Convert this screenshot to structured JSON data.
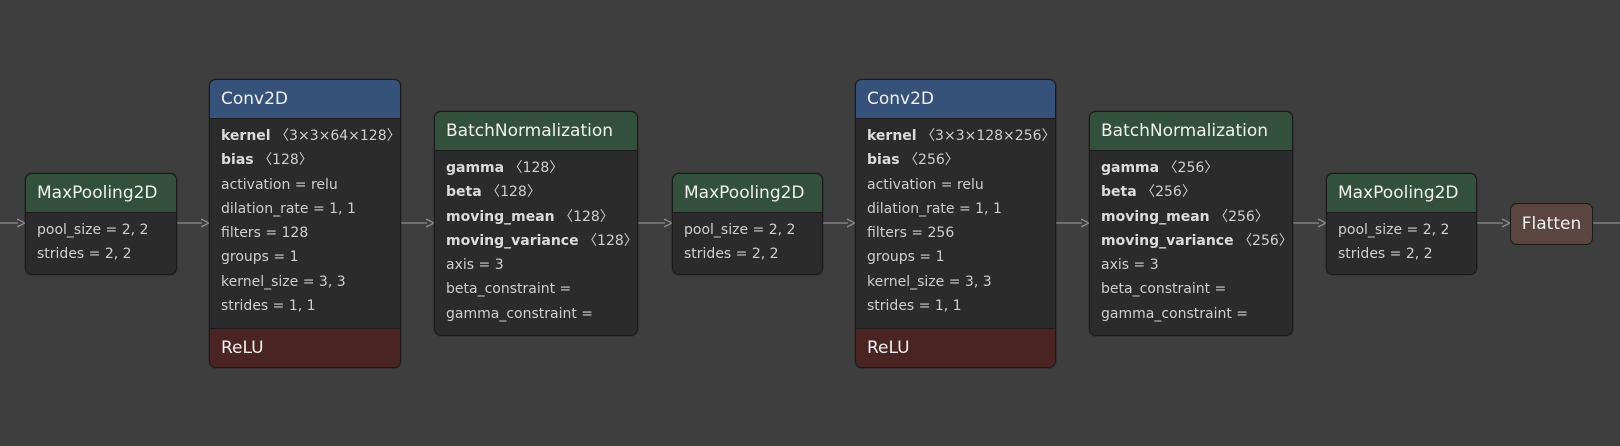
{
  "graph": {
    "edge_color": "#8a8a8a",
    "nodes": [
      {
        "id": "maxpool-1",
        "type": "MaxPooling2D",
        "attrs": [
          {
            "name": "pool_size",
            "value": "2, 2"
          },
          {
            "name": "strides",
            "value": "2, 2"
          }
        ]
      },
      {
        "id": "conv2d-1",
        "type": "Conv2D",
        "weights": [
          {
            "name": "kernel",
            "shape": "〈3×3×64×128〉"
          },
          {
            "name": "bias",
            "shape": "〈128〉"
          }
        ],
        "attrs": [
          {
            "name": "activation",
            "value": "relu"
          },
          {
            "name": "dilation_rate",
            "value": "1, 1"
          },
          {
            "name": "filters",
            "value": "128"
          },
          {
            "name": "groups",
            "value": "1"
          },
          {
            "name": "kernel_size",
            "value": "3, 3"
          },
          {
            "name": "strides",
            "value": "1, 1"
          }
        ],
        "activation": "ReLU"
      },
      {
        "id": "batchnorm-1",
        "type": "BatchNormalization",
        "weights": [
          {
            "name": "gamma",
            "shape": "〈128〉"
          },
          {
            "name": "beta",
            "shape": "〈128〉"
          },
          {
            "name": "moving_mean",
            "shape": "〈128〉"
          },
          {
            "name": "moving_variance",
            "shape": "〈128〉"
          }
        ],
        "attrs": [
          {
            "name": "axis",
            "value": "3"
          },
          {
            "name": "beta_constraint",
            "value": ""
          },
          {
            "name": "gamma_constraint",
            "value": ""
          }
        ]
      },
      {
        "id": "maxpool-2",
        "type": "MaxPooling2D",
        "attrs": [
          {
            "name": "pool_size",
            "value": "2, 2"
          },
          {
            "name": "strides",
            "value": "2, 2"
          }
        ]
      },
      {
        "id": "conv2d-2",
        "type": "Conv2D",
        "weights": [
          {
            "name": "kernel",
            "shape": "〈3×3×128×256〉"
          },
          {
            "name": "bias",
            "shape": "〈256〉"
          }
        ],
        "attrs": [
          {
            "name": "activation",
            "value": "relu"
          },
          {
            "name": "dilation_rate",
            "value": "1, 1"
          },
          {
            "name": "filters",
            "value": "256"
          },
          {
            "name": "groups",
            "value": "1"
          },
          {
            "name": "kernel_size",
            "value": "3, 3"
          },
          {
            "name": "strides",
            "value": "1, 1"
          }
        ],
        "activation": "ReLU"
      },
      {
        "id": "batchnorm-2",
        "type": "BatchNormalization",
        "weights": [
          {
            "name": "gamma",
            "shape": "〈256〉"
          },
          {
            "name": "beta",
            "shape": "〈256〉"
          },
          {
            "name": "moving_mean",
            "shape": "〈256〉"
          },
          {
            "name": "moving_variance",
            "shape": "〈256〉"
          }
        ],
        "attrs": [
          {
            "name": "axis",
            "value": "3"
          },
          {
            "name": "beta_constraint",
            "value": ""
          },
          {
            "name": "gamma_constraint",
            "value": ""
          }
        ]
      },
      {
        "id": "maxpool-3",
        "type": "MaxPooling2D",
        "attrs": [
          {
            "name": "pool_size",
            "value": "2, 2"
          },
          {
            "name": "strides",
            "value": "2, 2"
          }
        ]
      },
      {
        "id": "flatten-1",
        "type": "Flatten"
      }
    ]
  }
}
